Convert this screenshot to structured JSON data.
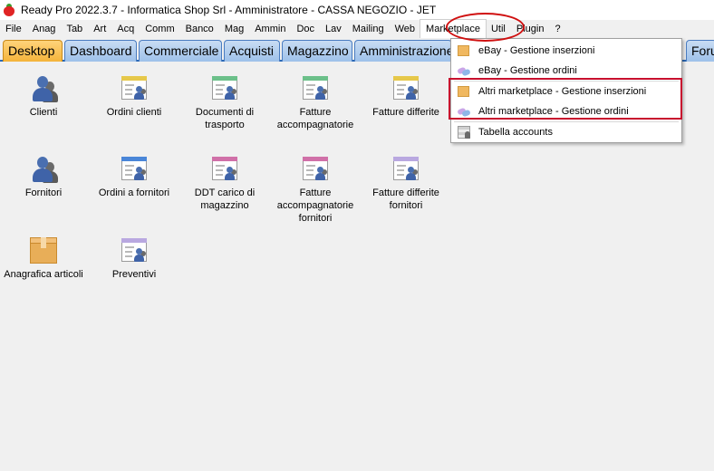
{
  "window": {
    "title": "Ready Pro 2022.3.7 - Informatica Shop Srl - Amministratore - CASSA NEGOZIO - JET",
    "app_icon": "strawberry-icon"
  },
  "menubar": {
    "items": [
      "File",
      "Anag",
      "Tab",
      "Art",
      "Acq",
      "Comm",
      "Banco",
      "Mag",
      "Ammin",
      "Doc",
      "Lav",
      "Mailing",
      "Web",
      "Marketplace",
      "Util",
      "Plugin",
      "?"
    ],
    "active": "Marketplace"
  },
  "tabs": {
    "items": [
      "Desktop",
      "Dashboard",
      "Commerciale",
      "Acquisti",
      "Magazzino",
      "Amministrazione",
      "Foru"
    ],
    "active": "Desktop"
  },
  "desktop": {
    "icons": [
      {
        "label": "Clienti",
        "icon": "customers-icon"
      },
      {
        "label": "Ordini clienti",
        "icon": "customer-orders-icon",
        "band_color": "#e6c84a"
      },
      {
        "label": "Documenti di trasporto",
        "icon": "transport-documents-icon",
        "band_color": "#6cc08a"
      },
      {
        "label": "Fatture accompagnatorie",
        "icon": "accompanying-invoices-icon",
        "band_color": "#6cc08a"
      },
      {
        "label": "Fatture differite",
        "icon": "deferred-invoices-icon",
        "band_color": "#e6c84a"
      },
      {
        "label": "Fornitori",
        "icon": "suppliers-icon"
      },
      {
        "label": "Ordini a fornitori",
        "icon": "supplier-orders-icon",
        "band_color": "#4a86d8"
      },
      {
        "label": "DDT carico di magazzino",
        "icon": "warehouse-ddt-icon",
        "band_color": "#d070a8"
      },
      {
        "label": "Fatture accompagnatorie fornitori",
        "icon": "supplier-accompanying-invoices-icon",
        "band_color": "#d070a8"
      },
      {
        "label": "Fatture differite fornitori",
        "icon": "supplier-deferred-invoices-icon",
        "band_color": "#b9a8e0"
      },
      {
        "label": "Anagrafica articoli",
        "icon": "articles-box-icon"
      },
      {
        "label": "Preventivi",
        "icon": "quotes-icon",
        "band_color": "#b9a8e0"
      }
    ]
  },
  "marketplace_menu": {
    "items": [
      {
        "label": "eBay - Gestione inserzioni",
        "icon": "listings-icon"
      },
      {
        "label": "eBay - Gestione ordini",
        "icon": "orders-icon"
      },
      {
        "label": "Altri marketplace - Gestione inserzioni",
        "icon": "listings-icon"
      },
      {
        "label": "Altri marketplace - Gestione ordini",
        "icon": "orders-icon"
      },
      {
        "label": "Tabella accounts",
        "icon": "accounts-table-icon"
      }
    ]
  },
  "annotations": {
    "highlight_color": "#d01010"
  }
}
